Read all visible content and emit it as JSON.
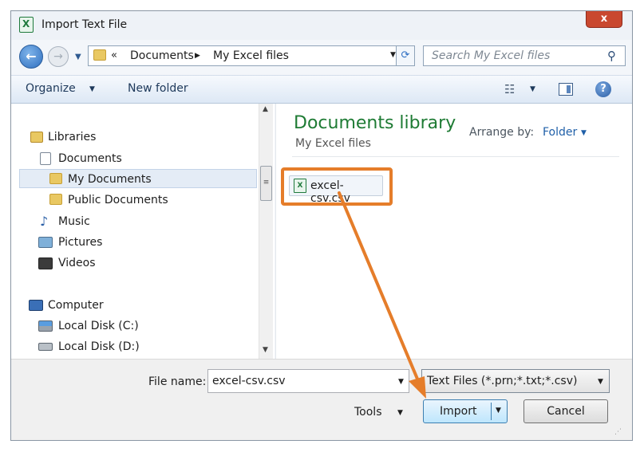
{
  "window": {
    "title": "Import Text File",
    "close_symbol": "x"
  },
  "nav": {
    "back_symbol": "←",
    "forward_symbol": "→",
    "address_prefix": "«",
    "address_segments": [
      "Documents",
      "My Excel files"
    ],
    "search_placeholder": "Search My Excel files"
  },
  "toolbar": {
    "organize": "Organize",
    "new_folder": "New folder",
    "help_symbol": "?"
  },
  "sidebar": {
    "items": [
      {
        "label": "Libraries"
      },
      {
        "label": "Documents"
      },
      {
        "label": "My Documents",
        "selected": true
      },
      {
        "label": "Public Documents"
      },
      {
        "label": "Music"
      },
      {
        "label": "Pictures"
      },
      {
        "label": "Videos"
      },
      {
        "label": "Computer"
      },
      {
        "label": "Local Disk (C:)"
      },
      {
        "label": "Local Disk (D:)"
      }
    ]
  },
  "main": {
    "title": "Documents library",
    "subtitle": "My Excel files",
    "arrange_label": "Arrange by:",
    "arrange_value": "Folder",
    "files": [
      {
        "name": "excel-csv.csv"
      }
    ]
  },
  "bottom": {
    "file_name_label": "File name:",
    "file_name_value": "excel-csv.csv",
    "file_type_value": "Text Files (*.prn;*.txt;*.csv)",
    "tools_label": "Tools",
    "import_label": "Import",
    "cancel_label": "Cancel"
  },
  "colors": {
    "annotation": "#e57d2a",
    "library_title": "#1e7b34",
    "link_blue": "#1f5fa8"
  }
}
